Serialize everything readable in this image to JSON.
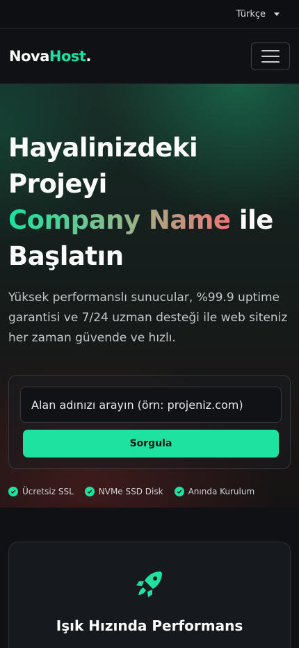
{
  "topbar": {
    "language": "Türkçe"
  },
  "navbar": {
    "brand_part1": "Nova",
    "brand_part2": "Host",
    "brand_part3": "."
  },
  "hero": {
    "title_line1": "Hayalinizdeki Projeyi",
    "title_gradient": "Company Name",
    "title_after_gradient": " ile",
    "title_line3": "Başlatın",
    "description": "Yüksek performanslı sunucular, %99.9 uptime garantisi ve 7/24 uzman desteği ile web siteniz her zaman güvende ve hızlı.",
    "search_placeholder": "Alan adınızı arayın (örn: projeniz.com)",
    "search_button": "Sorgula",
    "features": [
      "Ücretsiz SSL",
      "NVMe SSD Disk",
      "Anında Kurulum"
    ]
  },
  "card": {
    "title": "Işık Hızında Performans",
    "icon": "rocket-icon"
  },
  "colors": {
    "accent": "#1ee3a0",
    "gradient_end": "#f47474"
  }
}
